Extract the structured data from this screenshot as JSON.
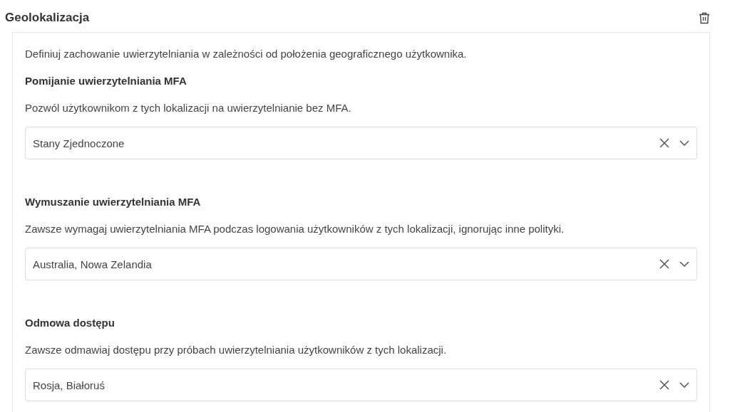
{
  "title": "Geolokalizacja",
  "description": "Definiuj zachowanie uwierzytelniania w zależności od położenia geograficznego użytkownika.",
  "sections": [
    {
      "heading": "Pomijanie uwierzytelniania MFA",
      "description": "Pozwól użytkownikom z tych lokalizacji na uwierzytelnianie bez MFA.",
      "value": "Stany Zjednoczone"
    },
    {
      "heading": "Wymuszanie uwierzytelniania MFA",
      "description": "Zawsze wymagaj uwierzytelniania MFA podczas logowania użytkowników z tych lokalizacji, ignorując inne polityki.",
      "value": "Australia, Nowa Zelandia"
    },
    {
      "heading": "Odmowa dostępu",
      "description": "Zawsze odmawiaj dostępu przy próbach uwierzytelniania użytkowników z tych lokalizacji.",
      "value": "Rosja, Białoruś"
    }
  ]
}
